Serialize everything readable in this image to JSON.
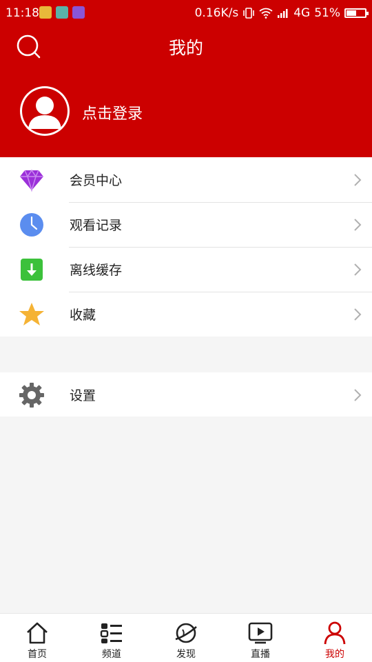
{
  "status_bar": {
    "time": "11:18",
    "network_speed": "0.16K/s",
    "network_type": "4G",
    "battery": "51%",
    "battery_level": 0.51
  },
  "header": {
    "title": "我的",
    "login_prompt": "点击登录"
  },
  "menu": {
    "items": [
      {
        "label": "会员中心",
        "icon": "diamond-icon",
        "color": "#9b30d9"
      },
      {
        "label": "观看记录",
        "icon": "clock-icon",
        "color": "#5b8def"
      },
      {
        "label": "离线缓存",
        "icon": "download-icon",
        "color": "#3cc13b"
      },
      {
        "label": "收藏",
        "icon": "star-icon",
        "color": "#f5b335"
      }
    ],
    "settings": {
      "label": "设置",
      "icon": "gear-icon",
      "color": "#666666"
    }
  },
  "tabs": [
    {
      "label": "首页",
      "icon": "home-icon"
    },
    {
      "label": "频道",
      "icon": "channel-icon"
    },
    {
      "label": "发现",
      "icon": "discover-icon"
    },
    {
      "label": "直播",
      "icon": "live-icon"
    },
    {
      "label": "我的",
      "icon": "profile-icon",
      "active": true
    }
  ],
  "colors": {
    "brand": "#cc0000",
    "background": "#f5f5f5"
  }
}
